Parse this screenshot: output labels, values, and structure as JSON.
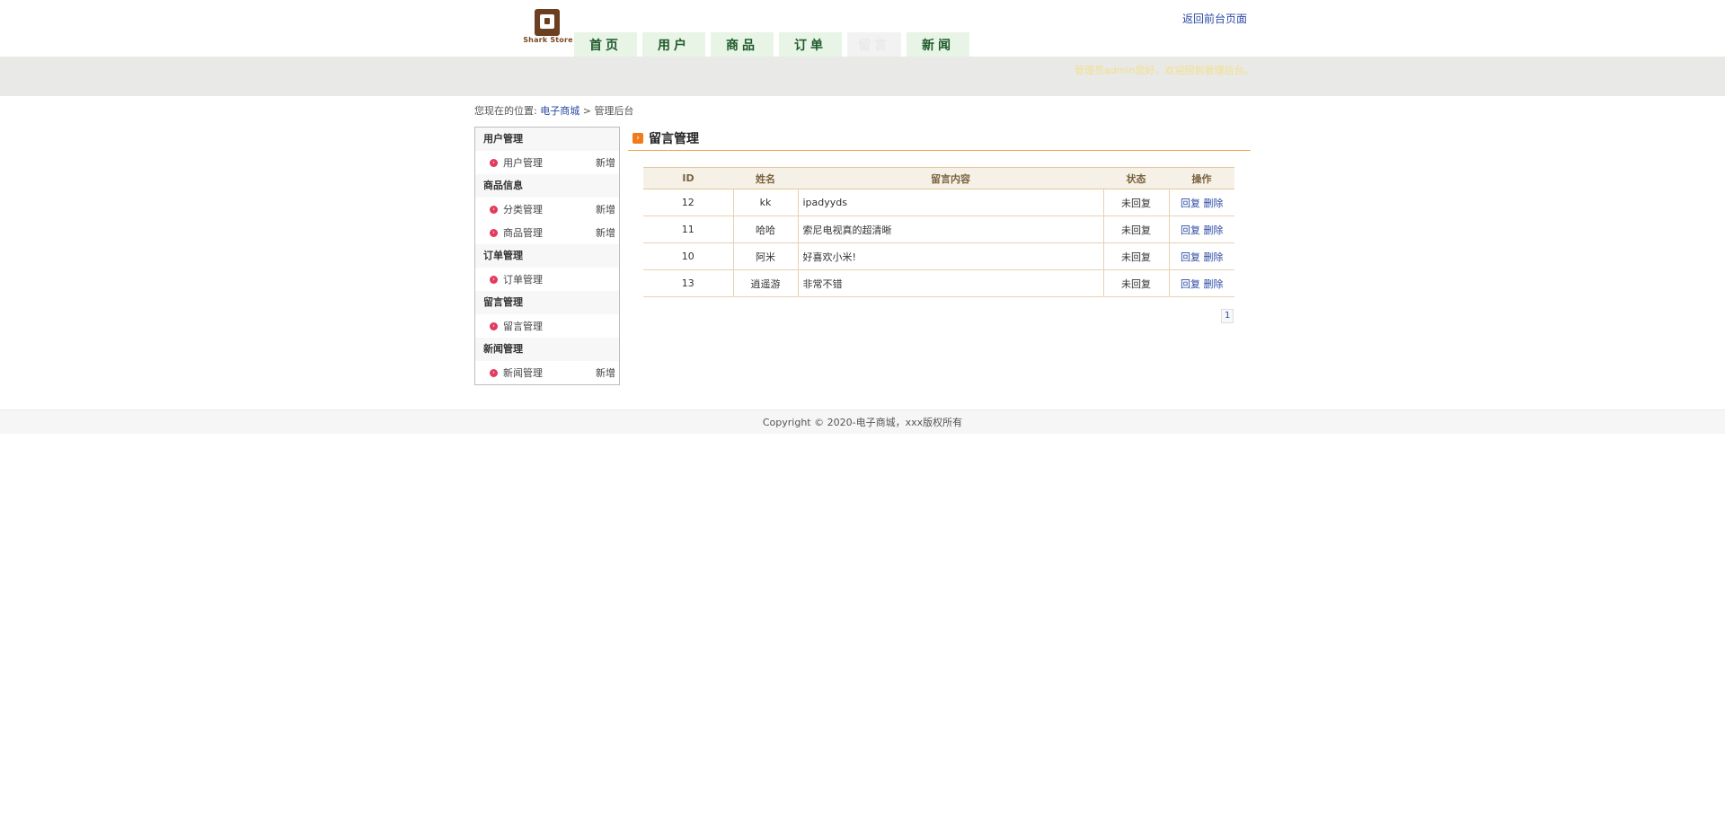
{
  "header": {
    "logo_text": "Shark Store",
    "back_link": "返回前台页面",
    "nav": [
      "首页",
      "用户",
      "商品",
      "订单",
      "留言",
      "新闻"
    ],
    "active_nav_index": 4
  },
  "status": {
    "welcome": "管理员admin您好，欢迎回到管理后台。"
  },
  "breadcrumb": {
    "prefix": "您现在的位置:",
    "home": "电子商城",
    "separator": ">",
    "current": "管理后台"
  },
  "sidebar": {
    "groups": [
      {
        "title": "用户管理",
        "items": [
          {
            "label": "用户管理",
            "add": "新增"
          }
        ]
      },
      {
        "title": "商品信息",
        "items": [
          {
            "label": "分类管理",
            "add": "新增"
          },
          {
            "label": "商品管理",
            "add": "新增"
          }
        ]
      },
      {
        "title": "订单管理",
        "items": [
          {
            "label": "订单管理",
            "add": ""
          }
        ]
      },
      {
        "title": "留言管理",
        "items": [
          {
            "label": "留言管理",
            "add": ""
          }
        ]
      },
      {
        "title": "新闻管理",
        "items": [
          {
            "label": "新闻管理",
            "add": "新增"
          }
        ]
      }
    ]
  },
  "main": {
    "title": "留言管理",
    "table": {
      "headers": [
        "ID",
        "姓名",
        "留言内容",
        "状态",
        "操作"
      ],
      "rows": [
        {
          "id": "12",
          "name": "kk",
          "content": "ipadyyds",
          "status": "未回复",
          "reply": "回复",
          "delete": "删除"
        },
        {
          "id": "11",
          "name": "哈哈",
          "content": "索尼电视真的超清晰",
          "status": "未回复",
          "reply": "回复",
          "delete": "删除"
        },
        {
          "id": "10",
          "name": "阿米",
          "content": "好喜欢小米!",
          "status": "未回复",
          "reply": "回复",
          "delete": "删除"
        },
        {
          "id": "13",
          "name": "逍遥游",
          "content": "非常不错",
          "status": "未回复",
          "reply": "回复",
          "delete": "删除"
        }
      ]
    },
    "pager": {
      "current_page": "1"
    }
  },
  "footer": {
    "copyright": "Copyright © 2020-电子商城，xxx版权所有"
  }
}
